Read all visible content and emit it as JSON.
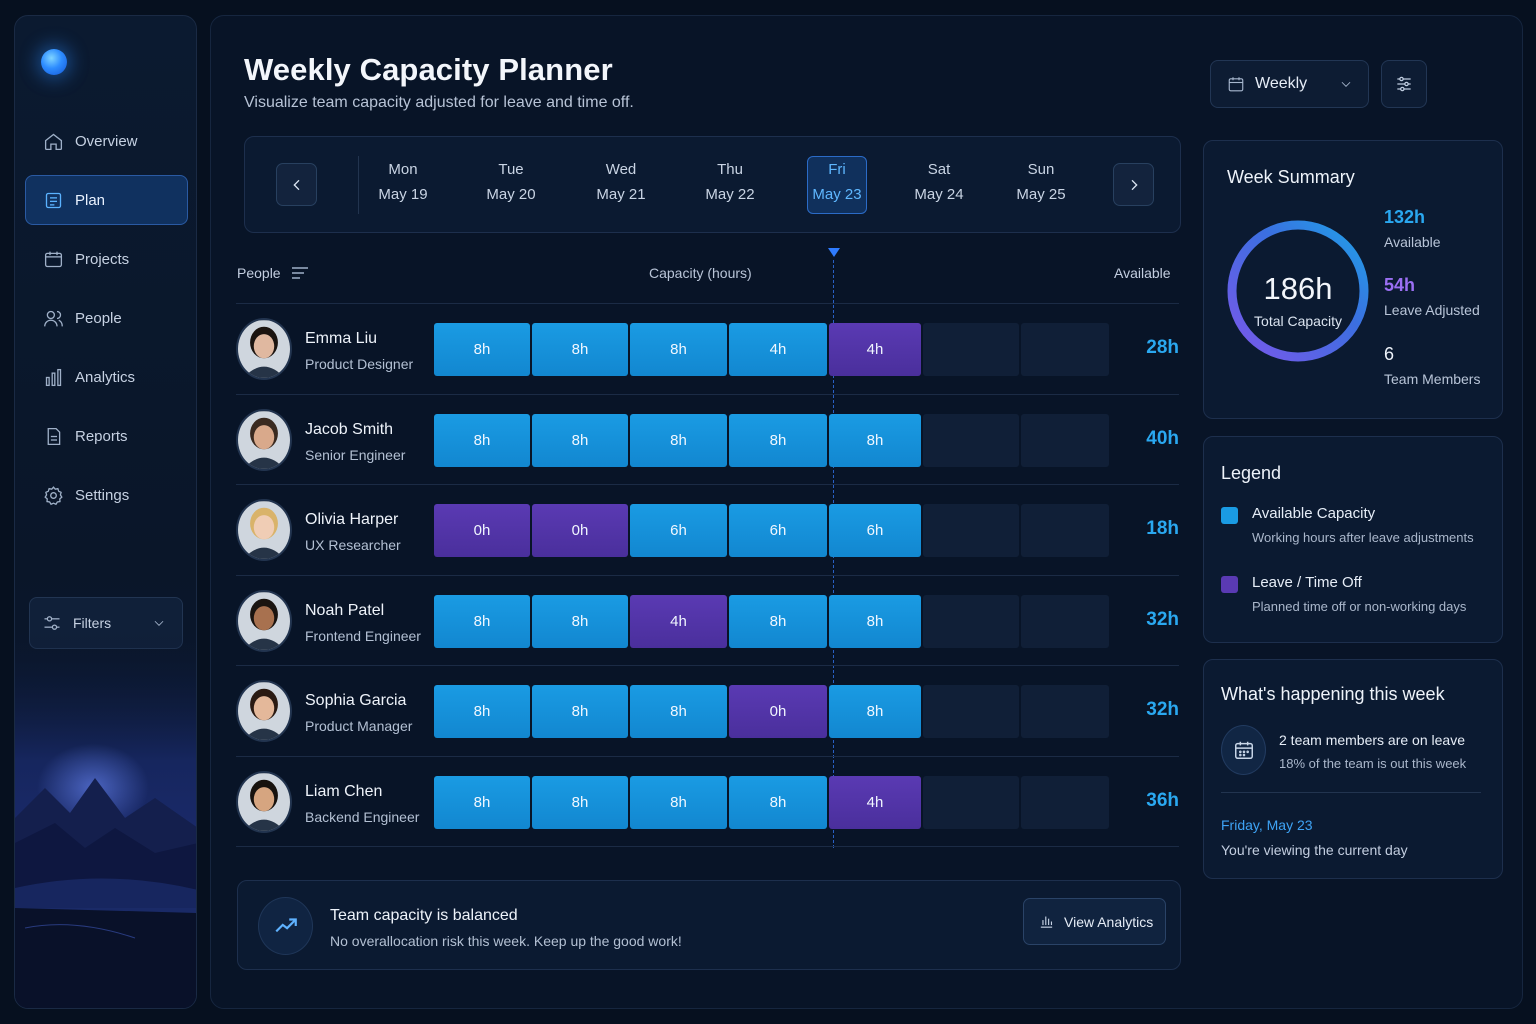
{
  "sidebar": {
    "items": [
      {
        "label": "Overview",
        "icon": "home-icon"
      },
      {
        "label": "Plan",
        "icon": "plan-icon",
        "active": true
      },
      {
        "label": "Projects",
        "icon": "folder-icon"
      },
      {
        "label": "People",
        "icon": "people-icon"
      },
      {
        "label": "Analytics",
        "icon": "analytics-icon"
      },
      {
        "label": "Reports",
        "icon": "report-icon"
      },
      {
        "label": "Settings",
        "icon": "gear-icon"
      }
    ],
    "filters_label": "Filters"
  },
  "header": {
    "title": "Weekly Capacity Planner",
    "subtitle": "Visualize team capacity adjusted for leave and time off.",
    "view_select": "Weekly"
  },
  "days": [
    {
      "name": "Mon",
      "date": "May 19"
    },
    {
      "name": "Tue",
      "date": "May 20"
    },
    {
      "name": "Wed",
      "date": "May 21"
    },
    {
      "name": "Thu",
      "date": "May 22"
    },
    {
      "name": "Fri",
      "date": "May 23",
      "active": true
    },
    {
      "name": "Sat",
      "date": "May 24"
    },
    {
      "name": "Sun",
      "date": "May 25"
    }
  ],
  "grid": {
    "people_header": "People",
    "capacity_header": "Capacity (hours)",
    "available_header": "Available",
    "rows": [
      {
        "name": "Emma Liu",
        "role": "Product Designer",
        "cells": [
          {
            "v": "8h",
            "t": "blue"
          },
          {
            "v": "8h",
            "t": "blue"
          },
          {
            "v": "8h",
            "t": "blue"
          },
          {
            "v": "4h",
            "t": "blue"
          },
          {
            "v": "4h",
            "t": "purple"
          }
        ],
        "available": "28h"
      },
      {
        "name": "Jacob Smith",
        "role": "Senior Engineer",
        "cells": [
          {
            "v": "8h",
            "t": "blue"
          },
          {
            "v": "8h",
            "t": "blue"
          },
          {
            "v": "8h",
            "t": "blue"
          },
          {
            "v": "8h",
            "t": "blue"
          },
          {
            "v": "8h",
            "t": "blue"
          }
        ],
        "available": "40h"
      },
      {
        "name": "Olivia Harper",
        "role": "UX Researcher",
        "cells": [
          {
            "v": "0h",
            "t": "purple"
          },
          {
            "v": "0h",
            "t": "purple"
          },
          {
            "v": "6h",
            "t": "blue"
          },
          {
            "v": "6h",
            "t": "blue"
          },
          {
            "v": "6h",
            "t": "blue"
          }
        ],
        "available": "18h"
      },
      {
        "name": "Noah Patel",
        "role": "Frontend Engineer",
        "cells": [
          {
            "v": "8h",
            "t": "blue"
          },
          {
            "v": "8h",
            "t": "blue"
          },
          {
            "v": "4h",
            "t": "purple"
          },
          {
            "v": "8h",
            "t": "blue"
          },
          {
            "v": "8h",
            "t": "blue"
          }
        ],
        "available": "32h"
      },
      {
        "name": "Sophia Garcia",
        "role": "Product Manager",
        "cells": [
          {
            "v": "8h",
            "t": "blue"
          },
          {
            "v": "8h",
            "t": "blue"
          },
          {
            "v": "8h",
            "t": "blue"
          },
          {
            "v": "0h",
            "t": "purple"
          },
          {
            "v": "8h",
            "t": "blue"
          }
        ],
        "available": "32h"
      },
      {
        "name": "Liam Chen",
        "role": "Backend Engineer",
        "cells": [
          {
            "v": "8h",
            "t": "blue"
          },
          {
            "v": "8h",
            "t": "blue"
          },
          {
            "v": "8h",
            "t": "blue"
          },
          {
            "v": "8h",
            "t": "blue"
          },
          {
            "v": "4h",
            "t": "purple"
          }
        ],
        "available": "36h"
      }
    ]
  },
  "banner": {
    "title": "Team capacity is balanced",
    "subtitle": "No overallocation risk this week. Keep up the good work!",
    "button_label": "View Analytics"
  },
  "summary": {
    "title": "Week Summary",
    "total_value": "186h",
    "total_label": "Total Capacity",
    "available_value": "132h",
    "available_label": "Available",
    "leave_value": "54h",
    "leave_label": "Leave Adjusted",
    "members_value": "6",
    "members_label": "Team Members"
  },
  "legend": {
    "title": "Legend",
    "items": [
      {
        "name": "Available Capacity",
        "desc": "Working hours after leave adjustments",
        "color": "#1a9be3"
      },
      {
        "name": "Leave / Time Off",
        "desc": "Planned time off or non-working days",
        "color": "#5a3ab3"
      }
    ]
  },
  "happening": {
    "title": "What's happening this week",
    "line1": "2 team members are on leave",
    "line2": "18% of the team is out this week",
    "date": "Friday, May 23",
    "note": "You're viewing the current day"
  },
  "colors": {
    "available": "#1a9be3",
    "leave": "#5a3ab3",
    "accent": "#2aa8f0"
  }
}
